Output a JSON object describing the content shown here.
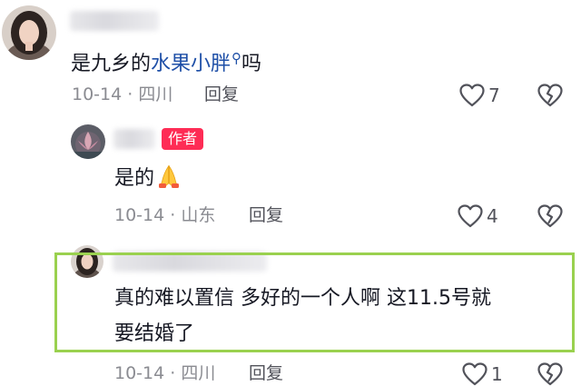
{
  "comments": [
    {
      "text_plain": "是九乡的",
      "link_text": "水果小胖",
      "link_icon": "search-icon",
      "text_suffix": "吗",
      "meta": "10-14 · 四川",
      "reply_label": "回复",
      "likes": "7"
    },
    {
      "author_badge": "作者",
      "text_plain": "是的",
      "emoji": "folded-hands-emoji",
      "meta": "10-14 · 山东",
      "reply_label": "回复",
      "likes": "4"
    },
    {
      "text_line1": "真的难以置信  多好的一个人啊  这11.5号就",
      "text_line2": "要结婚了",
      "meta": "10-14 · 四川",
      "reply_label": "回复",
      "likes": "1"
    }
  ],
  "colors": {
    "highlight_border": "#9ad14f",
    "author_badge_bg": "#fe2c55",
    "link": "#1e4fa7"
  }
}
